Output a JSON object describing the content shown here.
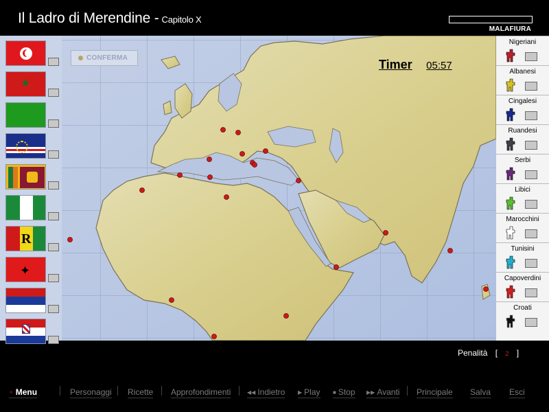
{
  "header": {
    "title": "Il Ladro di Merendine -",
    "subtitle": "Capitolo X",
    "brand": "MALAFIURA"
  },
  "map": {
    "confirm_label": "CONFERMA",
    "timer_label": "Timer",
    "timer_value": "05:57"
  },
  "flags": [
    {
      "name": "tunisia-flag"
    },
    {
      "name": "morocco-flag"
    },
    {
      "name": "libya-flag"
    },
    {
      "name": "cape-verde-flag"
    },
    {
      "name": "sri-lanka-flag"
    },
    {
      "name": "nigeria-flag"
    },
    {
      "name": "rwanda-flag"
    },
    {
      "name": "albania-flag"
    },
    {
      "name": "serbia-flag"
    },
    {
      "name": "croatia-flag"
    }
  ],
  "suspects": [
    {
      "label": "Nigeriani",
      "color": "#b8202a"
    },
    {
      "label": "Albanesi",
      "color": "#d8c020"
    },
    {
      "label": "Cingalesi",
      "color": "#1a2a8a"
    },
    {
      "label": "Ruandesi",
      "color": "#404048"
    },
    {
      "label": "Serbi",
      "color": "#6a2a7a"
    },
    {
      "label": "Libici",
      "color": "#5ac030"
    },
    {
      "label": "Marocchini",
      "color": "#ffffff"
    },
    {
      "label": "Tunisini",
      "color": "#20b0d0"
    },
    {
      "label": "Capoverdini",
      "color": "#d02020"
    },
    {
      "label": "Croati",
      "color": "#101010"
    }
  ],
  "penalty": {
    "label": "Penalità",
    "open": "[",
    "value": "2",
    "close": "]"
  },
  "menu": {
    "menu": "Menu",
    "personaggi": "Personaggi",
    "ricette": "Ricette",
    "approfondimenti": "Approfondimenti",
    "indietro": "Indietro",
    "play": "Play",
    "stop": "Stop",
    "avanti": "Avanti",
    "principale": "Principale",
    "salva": "Salva",
    "esci": "Esci"
  }
}
